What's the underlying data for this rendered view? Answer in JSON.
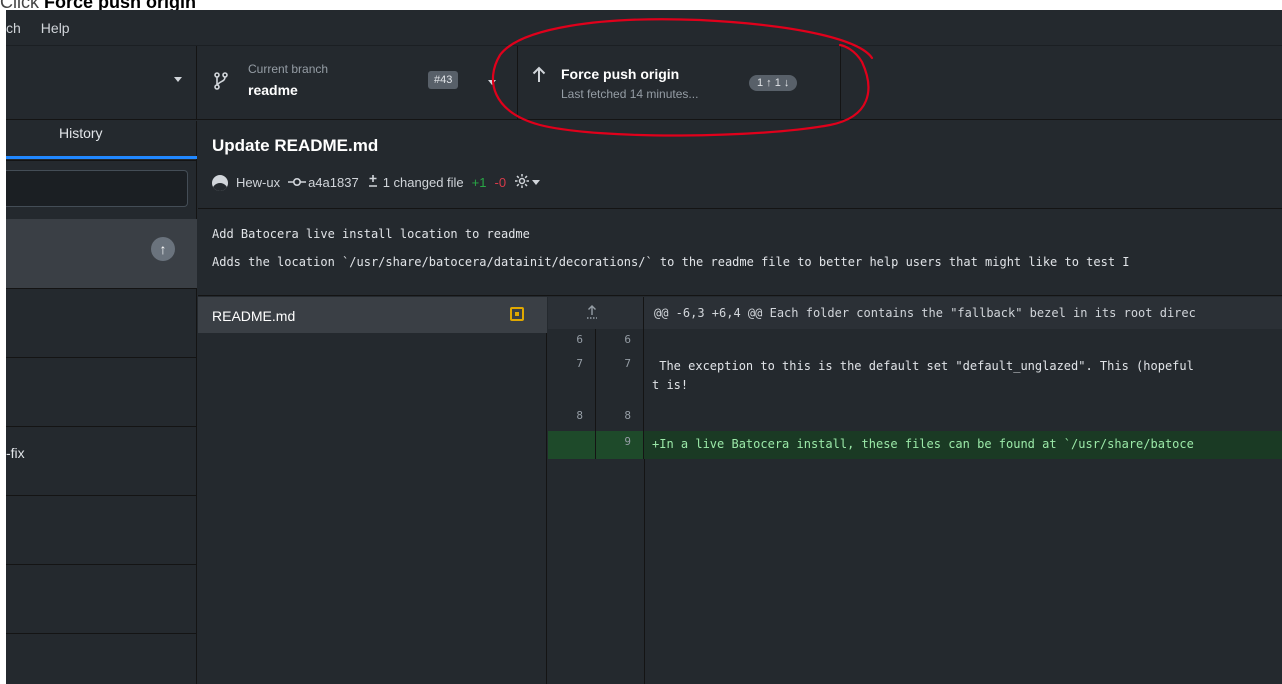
{
  "caption": {
    "prefix": "Click ",
    "target": "Force push origin"
  },
  "menu": {
    "items": [
      "ch",
      "Help"
    ]
  },
  "toolbar": {
    "current_branch_label": "Current branch",
    "current_branch_value": "readme",
    "pr_badge": "#43",
    "push_label": "Force push origin",
    "push_sub": "Last fetched 14 minutes...",
    "push_count": "1 ↑ 1 ↓"
  },
  "sidebar": {
    "tab_history": "History",
    "rows": [
      "",
      "",
      "",
      "-fix",
      "",
      "",
      ""
    ]
  },
  "commit": {
    "title": "Update README.md",
    "author": "Hew-ux",
    "sha": "a4a1837",
    "changed_files": "1 changed file",
    "additions": "+1",
    "deletions": "-0",
    "description_line1": "Add Batocera live install location to readme",
    "description_line2": "Adds the location `/usr/share/batocera/datainit/decorations/` to the readme file to better help users that might like to test I"
  },
  "files": [
    {
      "name": "README.md",
      "status": "modified"
    }
  ],
  "diff": {
    "hunk_header": "@@ -6,3 +6,4 @@ Each folder contains the \"fallback\" bezel in its root direc",
    "lines": [
      {
        "old": "6",
        "new": "6",
        "type": "context",
        "text": ""
      },
      {
        "old": "7",
        "new": "7",
        "type": "context",
        "text": " The exception to this is the default set \"default_unglazed\". This (hopeful\nt is!"
      },
      {
        "old": "8",
        "new": "8",
        "type": "context",
        "text": ""
      },
      {
        "old": "",
        "new": "9",
        "type": "add",
        "text": "+In a live Batocera install, these files can be found at `/usr/share/batoce"
      }
    ]
  },
  "colors": {
    "bg": "#24292e",
    "accent_blue": "#2188ff",
    "addition_green": "#28a745",
    "deletion_red": "#d73a49",
    "annotation_red": "#e0001b"
  },
  "icons": {
    "branch": "git-branch-icon",
    "push": "arrow-up-icon",
    "commit": "git-commit-icon",
    "diff_stat": "diff-icon",
    "settings": "gear-icon",
    "expand": "expand-up-icon"
  }
}
